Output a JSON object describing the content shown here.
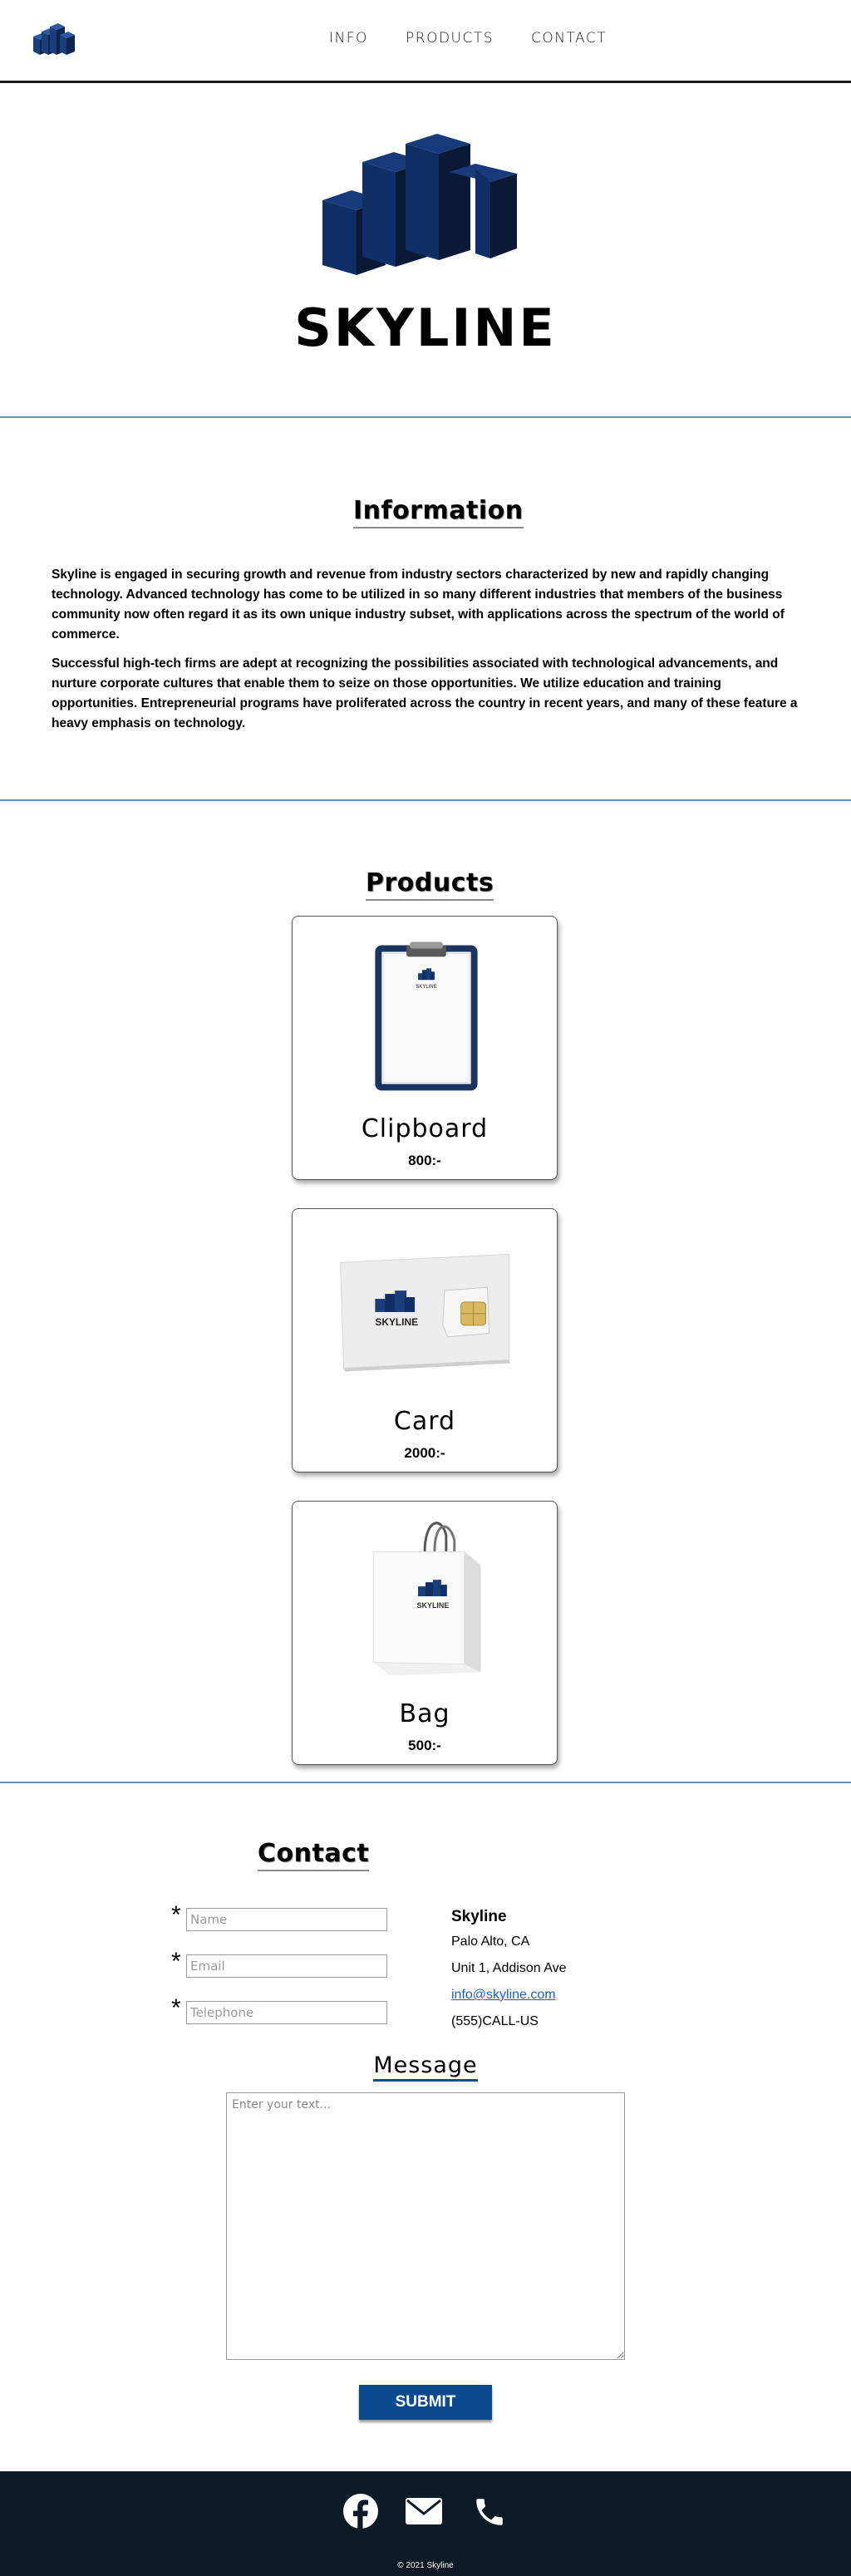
{
  "nav": {
    "links": [
      "INFO",
      "PRODUCTS",
      "CONTACT"
    ]
  },
  "hero": {
    "title": "SKYLINE"
  },
  "info": {
    "title": "Information",
    "paragraphs": [
      "Skyline is engaged in securing growth and revenue from industry sectors characterized by new and rapidly changing technology. Advanced technology has come to be utilized in so many different industries that members of the business community now often regard it as its own unique industry subset, with applications across the spectrum of the world of commerce.",
      "Successful high-tech firms are adept at recognizing the possibilities associated with technological advancements, and nurture corporate cultures that enable them to seize on those opportunities. We utilize education and training opportunities. Entrepreneurial programs have proliferated across the country in recent years, and many of these feature a heavy emphasis on technology."
    ]
  },
  "products": {
    "title": "Products",
    "items": [
      {
        "name": "Clipboard",
        "price": "800:-",
        "logo_text": "SKYLINE"
      },
      {
        "name": "Card",
        "price": "2000:-",
        "logo_text": "SKYLINE"
      },
      {
        "name": "Bag",
        "price": "500:-",
        "logo_text": "SKYLINE"
      }
    ]
  },
  "contact": {
    "title": "Contact",
    "form": {
      "required_mark": "*",
      "name_placeholder": "Name",
      "email_placeholder": "Email",
      "telephone_placeholder": "Telephone"
    },
    "company": "Skyline",
    "city": "Palo Alto, CA",
    "address": "Unit 1, Addison Ave",
    "email": "info@skyline.com",
    "phone": "(555)CALL-US",
    "message_title": "Message",
    "message_placeholder": "Enter your text...",
    "submit_label": "SUBMIT"
  },
  "footer": {
    "icons": [
      "facebook-icon",
      "mail-icon",
      "phone-icon"
    ],
    "copyright": "© 2021 Skyline"
  },
  "colors": {
    "brand_blue": "#0b4a8e",
    "divider": "#6b8fc4",
    "footer_bg": "#0c1a23"
  }
}
